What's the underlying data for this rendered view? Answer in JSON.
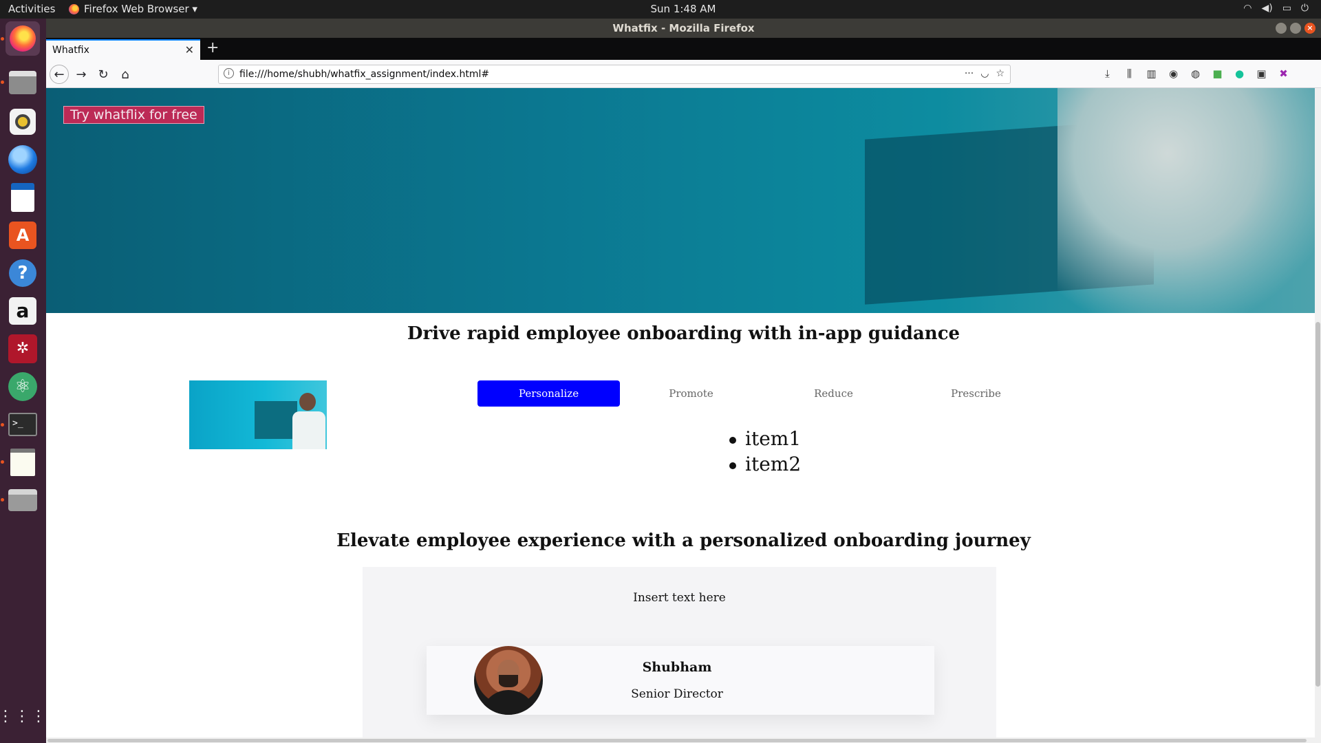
{
  "system": {
    "activities": "Activities",
    "app_menu": "Firefox Web Browser ▾",
    "clock": "Sun  1:48 AM",
    "tray_icons": [
      "wifi-icon",
      "volume-icon",
      "battery-icon",
      "power-icon"
    ]
  },
  "window": {
    "title": "Whatfix - Mozilla Firefox"
  },
  "dock": {
    "items": [
      "firefox-icon",
      "files-icon",
      "rhythmbox-icon",
      "thunderbird-icon",
      "writer-icon",
      "software-center-icon",
      "help-icon",
      "amazon-icon",
      "mendeley-icon",
      "atom-icon",
      "terminal-icon",
      "text-editor-icon",
      "printer-icon"
    ],
    "show_apps": "show-applications-icon"
  },
  "browser": {
    "tab_title": "Whatfix",
    "tab_close": "✕",
    "new_tab": "+",
    "url": "file:///home/shubh/whatfix_assignment/index.html#",
    "url_actions": "···"
  },
  "page": {
    "cta": "Try whatflix for free",
    "heading1": "Drive rapid employee onboarding with in-app guidance",
    "tabs": [
      "Personalize",
      "Promote",
      "Reduce",
      "Prescribe"
    ],
    "active_tab": "Personalize",
    "items": [
      "item1",
      "item2"
    ],
    "heading2": "Elevate employee experience with a personalized onboarding journey",
    "insert_text": "Insert text here",
    "profile": {
      "name": "Shubham",
      "role": "Senior Director"
    }
  },
  "colors": {
    "cta_bg": "#bc2a56",
    "active_tab_bg": "#0000ff",
    "hero_teal": "#0b7891",
    "dock_bg": "#3b2134"
  }
}
